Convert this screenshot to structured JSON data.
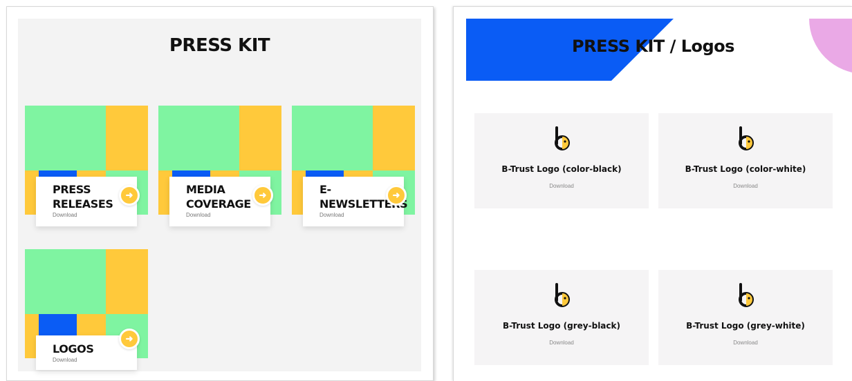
{
  "left": {
    "title": "PRESS KIT",
    "cards": [
      {
        "title": "PRESS\nRELEASES",
        "download": "Download"
      },
      {
        "title": "MEDIA\nCOVERAGE",
        "download": "Download"
      },
      {
        "title": "E-\nNEWSLETTERS",
        "download": "Download"
      },
      {
        "title": "LOGOS",
        "download": "Download"
      }
    ],
    "arrow_icon": "arrow-right-icon"
  },
  "right": {
    "title": "PRESS KIT / Logos",
    "logos": [
      {
        "name": "B-Trust Logo (color-black)",
        "download": "Download"
      },
      {
        "name": "B-Trust Logo (color-white)",
        "download": "Download"
      },
      {
        "name": "B-Trust Logo (grey-black)",
        "download": "Download"
      },
      {
        "name": "B-Trust Logo (grey-white)",
        "download": "Download"
      }
    ]
  },
  "colors": {
    "green": "#7ff4a1",
    "yellow": "#ffc93b",
    "blue": "#0a5cf5",
    "pink": "#eaa9e6",
    "panel_bg": "#f3f3f3"
  }
}
